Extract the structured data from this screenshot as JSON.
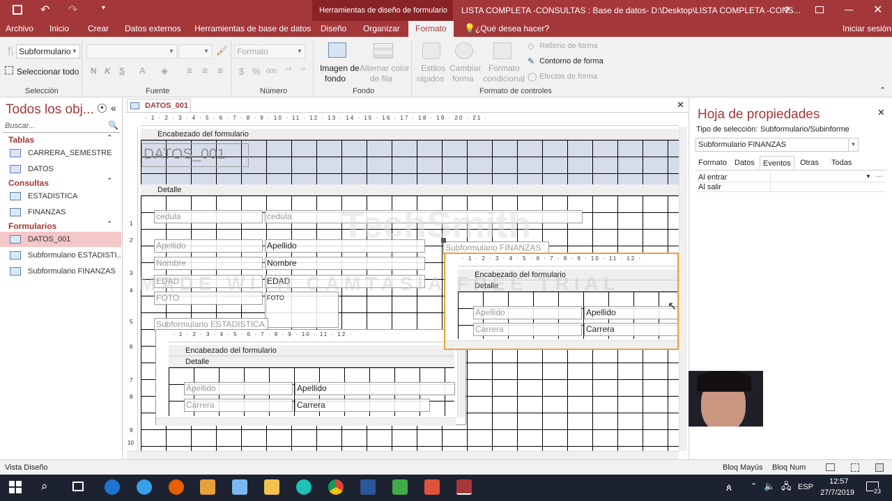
{
  "title": {
    "context_tab": "Herramientas de diseño de formulario",
    "window": "LISTA COMPLETA -CONSULTAS : Base de datos- D:\\Desktop\\LISTA COMPLETA -CONS...",
    "help": "?"
  },
  "tabs": {
    "archivo": "Archivo",
    "inicio": "Inicio",
    "crear": "Crear",
    "datos_externos": "Datos externos",
    "herramientas": "Herramientas de base de datos",
    "diseno": "Diseño",
    "organizar": "Organizar",
    "formato": "Formato",
    "tell": "¿Qué desea hacer?",
    "signin": "Iniciar sesión"
  },
  "ribbon": {
    "object_combo": "Subformulario",
    "select_all": "Seleccionar todo",
    "seleccion": "Selección",
    "fuente": "Fuente",
    "numero": "Número",
    "format_combo": "Formato",
    "imagen": "Imagen de",
    "fondo_btn": "fondo",
    "alternar": "Alternar color",
    "de_fila": "de fila",
    "fondo": "Fondo",
    "estilos": "Estilos",
    "rapidos": "rápidos",
    "cambiar": "Cambiar",
    "forma": "forma",
    "formato_cond": "Formato",
    "condicional": "condicional",
    "relleno": "Relleno de forma",
    "contorno": "Contorno de forma",
    "efectos": "Efectos de forma",
    "formato_controles": "Formato de controles",
    "bold": "N",
    "italic": "K",
    "underline": "S",
    "currency": "$",
    "percent": "%",
    "thousands": "000"
  },
  "nav": {
    "title": "Todos los obj...",
    "search": "Buscar...",
    "tablas": "Tablas",
    "consultas": "Consultas",
    "formularios": "Formularios",
    "items": [
      "CARRERA_SEMESTRE",
      "DATOS",
      "ESTADISTICA",
      "FINANZAS",
      "DATOS_001",
      "Subformulario ESTADISTI...",
      "Subformulario FINANZAS"
    ]
  },
  "doc": {
    "tab": "DATOS_001",
    "enc": "Encabezado del formulario",
    "det": "Detalle",
    "form_title": "DATOS_001",
    "ruler_main": "· 1 · 2 · 3 · 4 · 5 · 6 · 7 · 8 · 9 · 10 · 11 · 12 · 13 · 14 · 15 · 16 · 17 · 18 · 19 · 20 · 21 ·",
    "ruler_sub": "· 1 · 2 · 3 · 4 · 5 · 6 · 7 · 8 · 9 · 10 · 11 · 12 ·",
    "fields": {
      "cedula_lbl": "cedula",
      "cedula": "cedula",
      "apellido_lbl": "Apellido",
      "apellido": "Apellido",
      "nombre_lbl": "Nombre",
      "nombre": "Nombre",
      "edad_lbl": "EDAD",
      "edad": "EDAD",
      "foto_lbl": "FOTO",
      "foto": "FOTO",
      "sub_est": "Subformulario ESTADISTICA",
      "sub_fin": "Subformulario FINANZAS",
      "carrera_lbl": "Carrera",
      "carrera": "Carrera"
    },
    "vruler": [
      "1",
      "2",
      "3",
      "4",
      "5",
      "6",
      "7",
      "8",
      "9",
      "10"
    ]
  },
  "props": {
    "title": "Hoja de propiedades",
    "type_label": "Tipo de selección:",
    "type_value": "Subformulario/Subinforme",
    "combo": "Subformulario FINANZAS",
    "tabs": [
      "Formato",
      "Datos",
      "Eventos",
      "Otras",
      "Todas"
    ],
    "rows": [
      "Al entrar",
      "Al salir"
    ]
  },
  "status": {
    "left": "Vista Diseño",
    "caps": "Bloq Mayús",
    "num": "Bloq Num"
  },
  "taskbar": {
    "lang": "ESP",
    "time": "12:57",
    "date": "27/7/2019",
    "notif": "23"
  },
  "watermark": {
    "line1": "TechSmith",
    "line2": "MADE WITH CAMTASIA FREE TRIAL"
  }
}
